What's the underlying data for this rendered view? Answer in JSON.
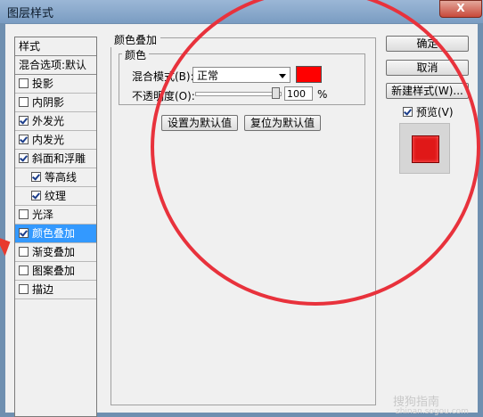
{
  "window": {
    "title": "图层样式",
    "close_glyph": "X"
  },
  "styles_panel": {
    "header": "样式",
    "blend_options": "混合选项:默认",
    "items": [
      {
        "label": "投影",
        "checked": false,
        "indent": false,
        "selected": false
      },
      {
        "label": "内阴影",
        "checked": false,
        "indent": false,
        "selected": false
      },
      {
        "label": "外发光",
        "checked": true,
        "indent": false,
        "selected": false
      },
      {
        "label": "内发光",
        "checked": true,
        "indent": false,
        "selected": false
      },
      {
        "label": "斜面和浮雕",
        "checked": true,
        "indent": false,
        "selected": false
      },
      {
        "label": "等高线",
        "checked": true,
        "indent": true,
        "selected": false
      },
      {
        "label": "纹理",
        "checked": true,
        "indent": true,
        "selected": false
      },
      {
        "label": "光泽",
        "checked": false,
        "indent": false,
        "selected": false
      },
      {
        "label": "颜色叠加",
        "checked": true,
        "indent": false,
        "selected": true
      },
      {
        "label": "渐变叠加",
        "checked": false,
        "indent": false,
        "selected": false
      },
      {
        "label": "图案叠加",
        "checked": false,
        "indent": false,
        "selected": false
      },
      {
        "label": "描边",
        "checked": false,
        "indent": false,
        "selected": false
      }
    ]
  },
  "color_overlay": {
    "section_title": "颜色叠加",
    "group_title": "颜色",
    "blend_mode_label": "混合模式(B):",
    "blend_mode_value": "正常",
    "overlay_color": "#ff0000",
    "opacity_label": "不透明度(O):",
    "opacity_value": "100",
    "opacity_unit": "%",
    "opacity_level": 1.0,
    "set_default_button": "设置为默认值",
    "reset_default_button": "复位为默认值"
  },
  "right_buttons": {
    "ok": "确定",
    "cancel": "取消",
    "new_style": "新建样式(W)...",
    "preview_label": "预览(V)",
    "preview_checked": true
  },
  "annotation_color": "#e8323c",
  "watermark": {
    "text": "搜狗指南",
    "url": "zhinan.sogou.com"
  }
}
